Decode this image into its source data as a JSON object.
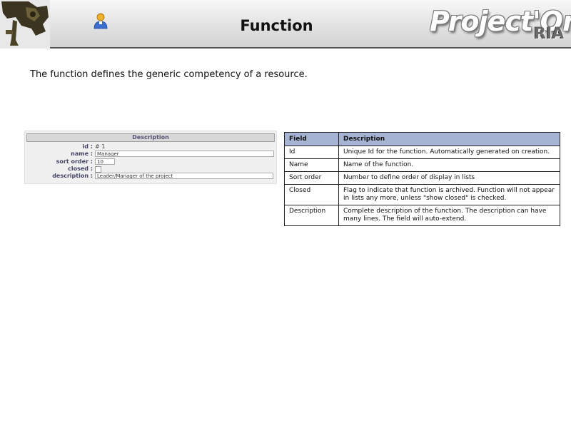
{
  "header": {
    "title": "Function",
    "brand": "Project'Or",
    "brand_sub": "RIA"
  },
  "intro": "The function defines the generic competency of a resource.",
  "form": {
    "section_title": "Description",
    "rows": [
      {
        "label": "id :",
        "value": "# 1"
      },
      {
        "label": "name :",
        "value": "Manager"
      },
      {
        "label": "sort order :",
        "value": "10"
      },
      {
        "label": "closed :",
        "value": ""
      },
      {
        "label": "description :",
        "value": "Leader/Manager of the project"
      }
    ]
  },
  "table": {
    "headers": [
      "Field",
      "Description"
    ],
    "rows": [
      {
        "field": "Id",
        "description": "Unique Id for the function. Automatically generated on creation."
      },
      {
        "field": "Name",
        "description": "Name of the function."
      },
      {
        "field": "Sort order",
        "description": "Number to define order of display in lists"
      },
      {
        "field": "Closed",
        "description": "Flag to indicate that function is archived. Function will not appear in lists any more, unless \"show closed\" is checked."
      },
      {
        "field": "Description",
        "description": "Complete description of the function. The description can have many lines. The field will auto-extend."
      }
    ]
  }
}
